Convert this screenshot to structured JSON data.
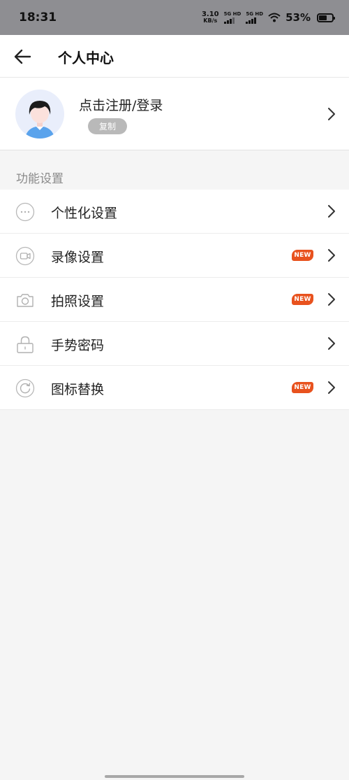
{
  "status_bar": {
    "time": "18:31",
    "net_speed_value": "3.10",
    "net_speed_unit": "KB/s",
    "signal_1_label": "5G HD",
    "signal_2_label": "5G HD",
    "battery_percent": "53%",
    "battery_level": 0.53
  },
  "header": {
    "title": "个人中心",
    "back_icon": "arrow-left-icon"
  },
  "profile": {
    "login_text": "点击注册/登录",
    "copy_label": "复制",
    "avatar_icon": "user-avatar-icon"
  },
  "section": {
    "label": "功能设置"
  },
  "menu": {
    "items": [
      {
        "label": "个性化设置",
        "icon": "more-dots-icon",
        "new_badge": ""
      },
      {
        "label": "录像设置",
        "icon": "video-camera-icon",
        "new_badge": "NEW"
      },
      {
        "label": "拍照设置",
        "icon": "camera-icon",
        "new_badge": "NEW"
      },
      {
        "label": "手势密码",
        "icon": "lock-icon",
        "new_badge": ""
      },
      {
        "label": "图标替换",
        "icon": "refresh-icon",
        "new_badge": "NEW"
      }
    ]
  },
  "colors": {
    "accent_badge": "#e8521e",
    "status_bar": "#8e8e92",
    "background": "#f5f5f5"
  }
}
